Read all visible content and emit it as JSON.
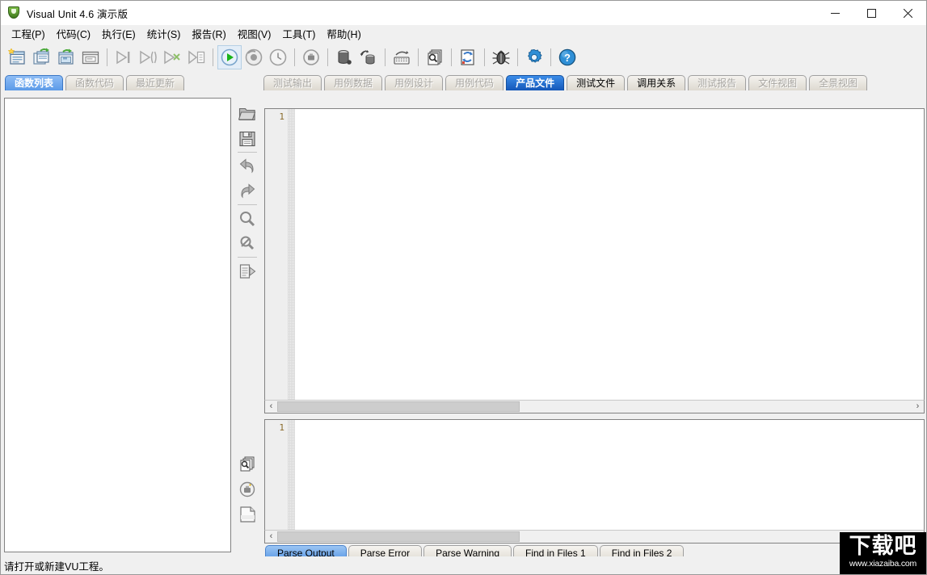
{
  "window": {
    "title": "Visual Unit 4.6 演示版",
    "app_icon": "shield-icon",
    "controls": {
      "minimize": "minimize-icon",
      "maximize": "maximize-icon",
      "close": "close-icon"
    }
  },
  "menubar": {
    "items": [
      {
        "label": "工程(P)"
      },
      {
        "label": "代码(C)"
      },
      {
        "label": "执行(E)"
      },
      {
        "label": "统计(S)"
      },
      {
        "label": "报告(R)"
      },
      {
        "label": "视图(V)"
      },
      {
        "label": "工具(T)"
      },
      {
        "label": "帮助(H)"
      }
    ]
  },
  "toolbar": {
    "groups": [
      {
        "buttons": [
          {
            "icon": "new-project-icon",
            "enabled": true
          },
          {
            "icon": "open-project-icon",
            "enabled": true
          },
          {
            "icon": "save-project-icon",
            "enabled": true
          },
          {
            "icon": "project-window-icon",
            "enabled": true
          }
        ]
      },
      {
        "buttons": [
          {
            "icon": "run-step-icon",
            "enabled": false
          },
          {
            "icon": "run-block-icon",
            "enabled": false
          },
          {
            "icon": "run-branch-icon",
            "enabled": false
          },
          {
            "icon": "run-list-icon",
            "enabled": false
          }
        ]
      },
      {
        "buttons": [
          {
            "icon": "play-icon",
            "enabled": true,
            "pressed": true
          },
          {
            "icon": "refresh-circle-icon",
            "enabled": false
          },
          {
            "icon": "clock-icon",
            "enabled": false
          }
        ]
      },
      {
        "buttons": [
          {
            "icon": "target-circle-icon",
            "enabled": false
          }
        ]
      },
      {
        "buttons": [
          {
            "icon": "database-icon",
            "enabled": true
          },
          {
            "icon": "database-sync-icon",
            "enabled": true
          }
        ]
      },
      {
        "buttons": [
          {
            "icon": "keyboard-icon",
            "enabled": true
          }
        ]
      },
      {
        "buttons": [
          {
            "icon": "find-pages-icon",
            "enabled": true
          }
        ]
      },
      {
        "buttons": [
          {
            "icon": "refresh-file-icon",
            "enabled": true
          }
        ]
      },
      {
        "buttons": [
          {
            "icon": "bug-icon",
            "enabled": true
          }
        ]
      },
      {
        "buttons": [
          {
            "icon": "settings-gear-icon",
            "enabled": true
          }
        ]
      },
      {
        "buttons": [
          {
            "icon": "help-icon",
            "enabled": true
          }
        ]
      }
    ]
  },
  "left_tabs": [
    {
      "label": "函数列表",
      "state": "active"
    },
    {
      "label": "函数代码",
      "state": "disabled"
    },
    {
      "label": "最近更新",
      "state": "disabled"
    }
  ],
  "right_tabs": [
    {
      "label": "测试输出",
      "state": "disabled"
    },
    {
      "label": "用例数据",
      "state": "disabled"
    },
    {
      "label": "用例设计",
      "state": "disabled"
    },
    {
      "label": "用例代码",
      "state": "disabled"
    },
    {
      "label": "产品文件",
      "state": "active"
    },
    {
      "label": "测试文件",
      "state": "enabled"
    },
    {
      "label": "调用关系",
      "state": "enabled"
    },
    {
      "label": "测试报告",
      "state": "disabled"
    },
    {
      "label": "文件视图",
      "state": "disabled"
    },
    {
      "label": "全景视图",
      "state": "disabled"
    }
  ],
  "bottom_tabs": [
    {
      "label": "Parse Output",
      "state": "active"
    },
    {
      "label": "Parse Error",
      "state": "enabled"
    },
    {
      "label": "Parse Warning",
      "state": "enabled"
    },
    {
      "label": "Find in Files 1",
      "state": "enabled"
    },
    {
      "label": "Find in Files 2",
      "state": "enabled"
    }
  ],
  "left_vtoolbar": [
    {
      "icon": "open-folder-icon"
    },
    {
      "icon": "save-floppy-icon"
    },
    {
      "icon": "undo-icon"
    },
    {
      "icon": "redo-icon"
    },
    {
      "icon": "search-icon"
    },
    {
      "icon": "search-cancel-icon"
    },
    {
      "icon": "goto-line-icon"
    }
  ],
  "lower_vtoolbar": [
    {
      "icon": "find-in-pages-icon"
    },
    {
      "icon": "target-circle-icon"
    },
    {
      "icon": "new-page-icon"
    }
  ],
  "editors": {
    "top": {
      "first_line_number": "1",
      "content": ""
    },
    "bottom": {
      "first_line_number": "1",
      "content": ""
    }
  },
  "left_panel": {
    "content": ""
  },
  "scrollbars": {
    "left_arrow": "‹",
    "right_arrow": "›"
  },
  "statusbar": {
    "text": "请打开或新建VU工程。"
  },
  "watermark": {
    "cn": "下载吧",
    "url": "www.xiazaiba.com"
  }
}
